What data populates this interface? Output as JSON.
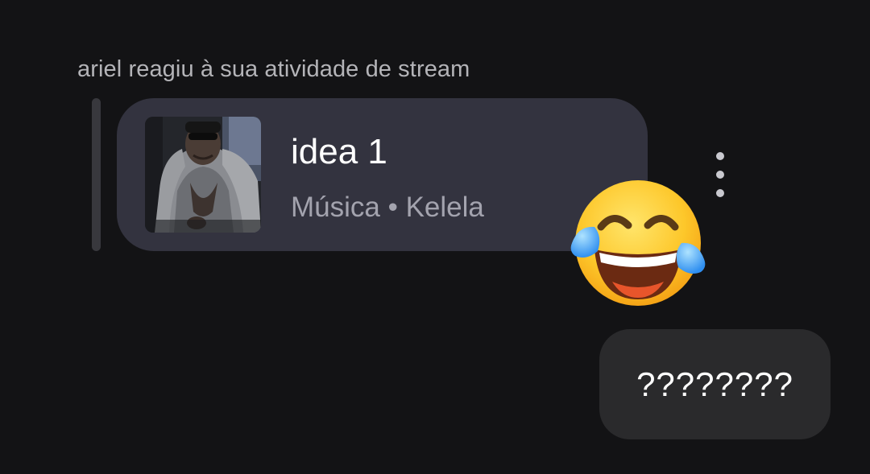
{
  "reaction": {
    "header": "ariel reagiu à sua atividade de stream",
    "emoji_icon": "face-with-tears-of-joy-icon"
  },
  "stream_card": {
    "title": "idea 1",
    "subtitle": "Música • Kelela",
    "album_art_icon": "album-art-image"
  },
  "more_menu_icon": "vertical-ellipsis-icon",
  "message": {
    "text": "????????"
  },
  "colors": {
    "background": "#131315",
    "card": "#33333f",
    "bubble": "#2a2a2c",
    "header_text": "#b4b4b8",
    "subtitle_text": "#a3a3ae"
  }
}
